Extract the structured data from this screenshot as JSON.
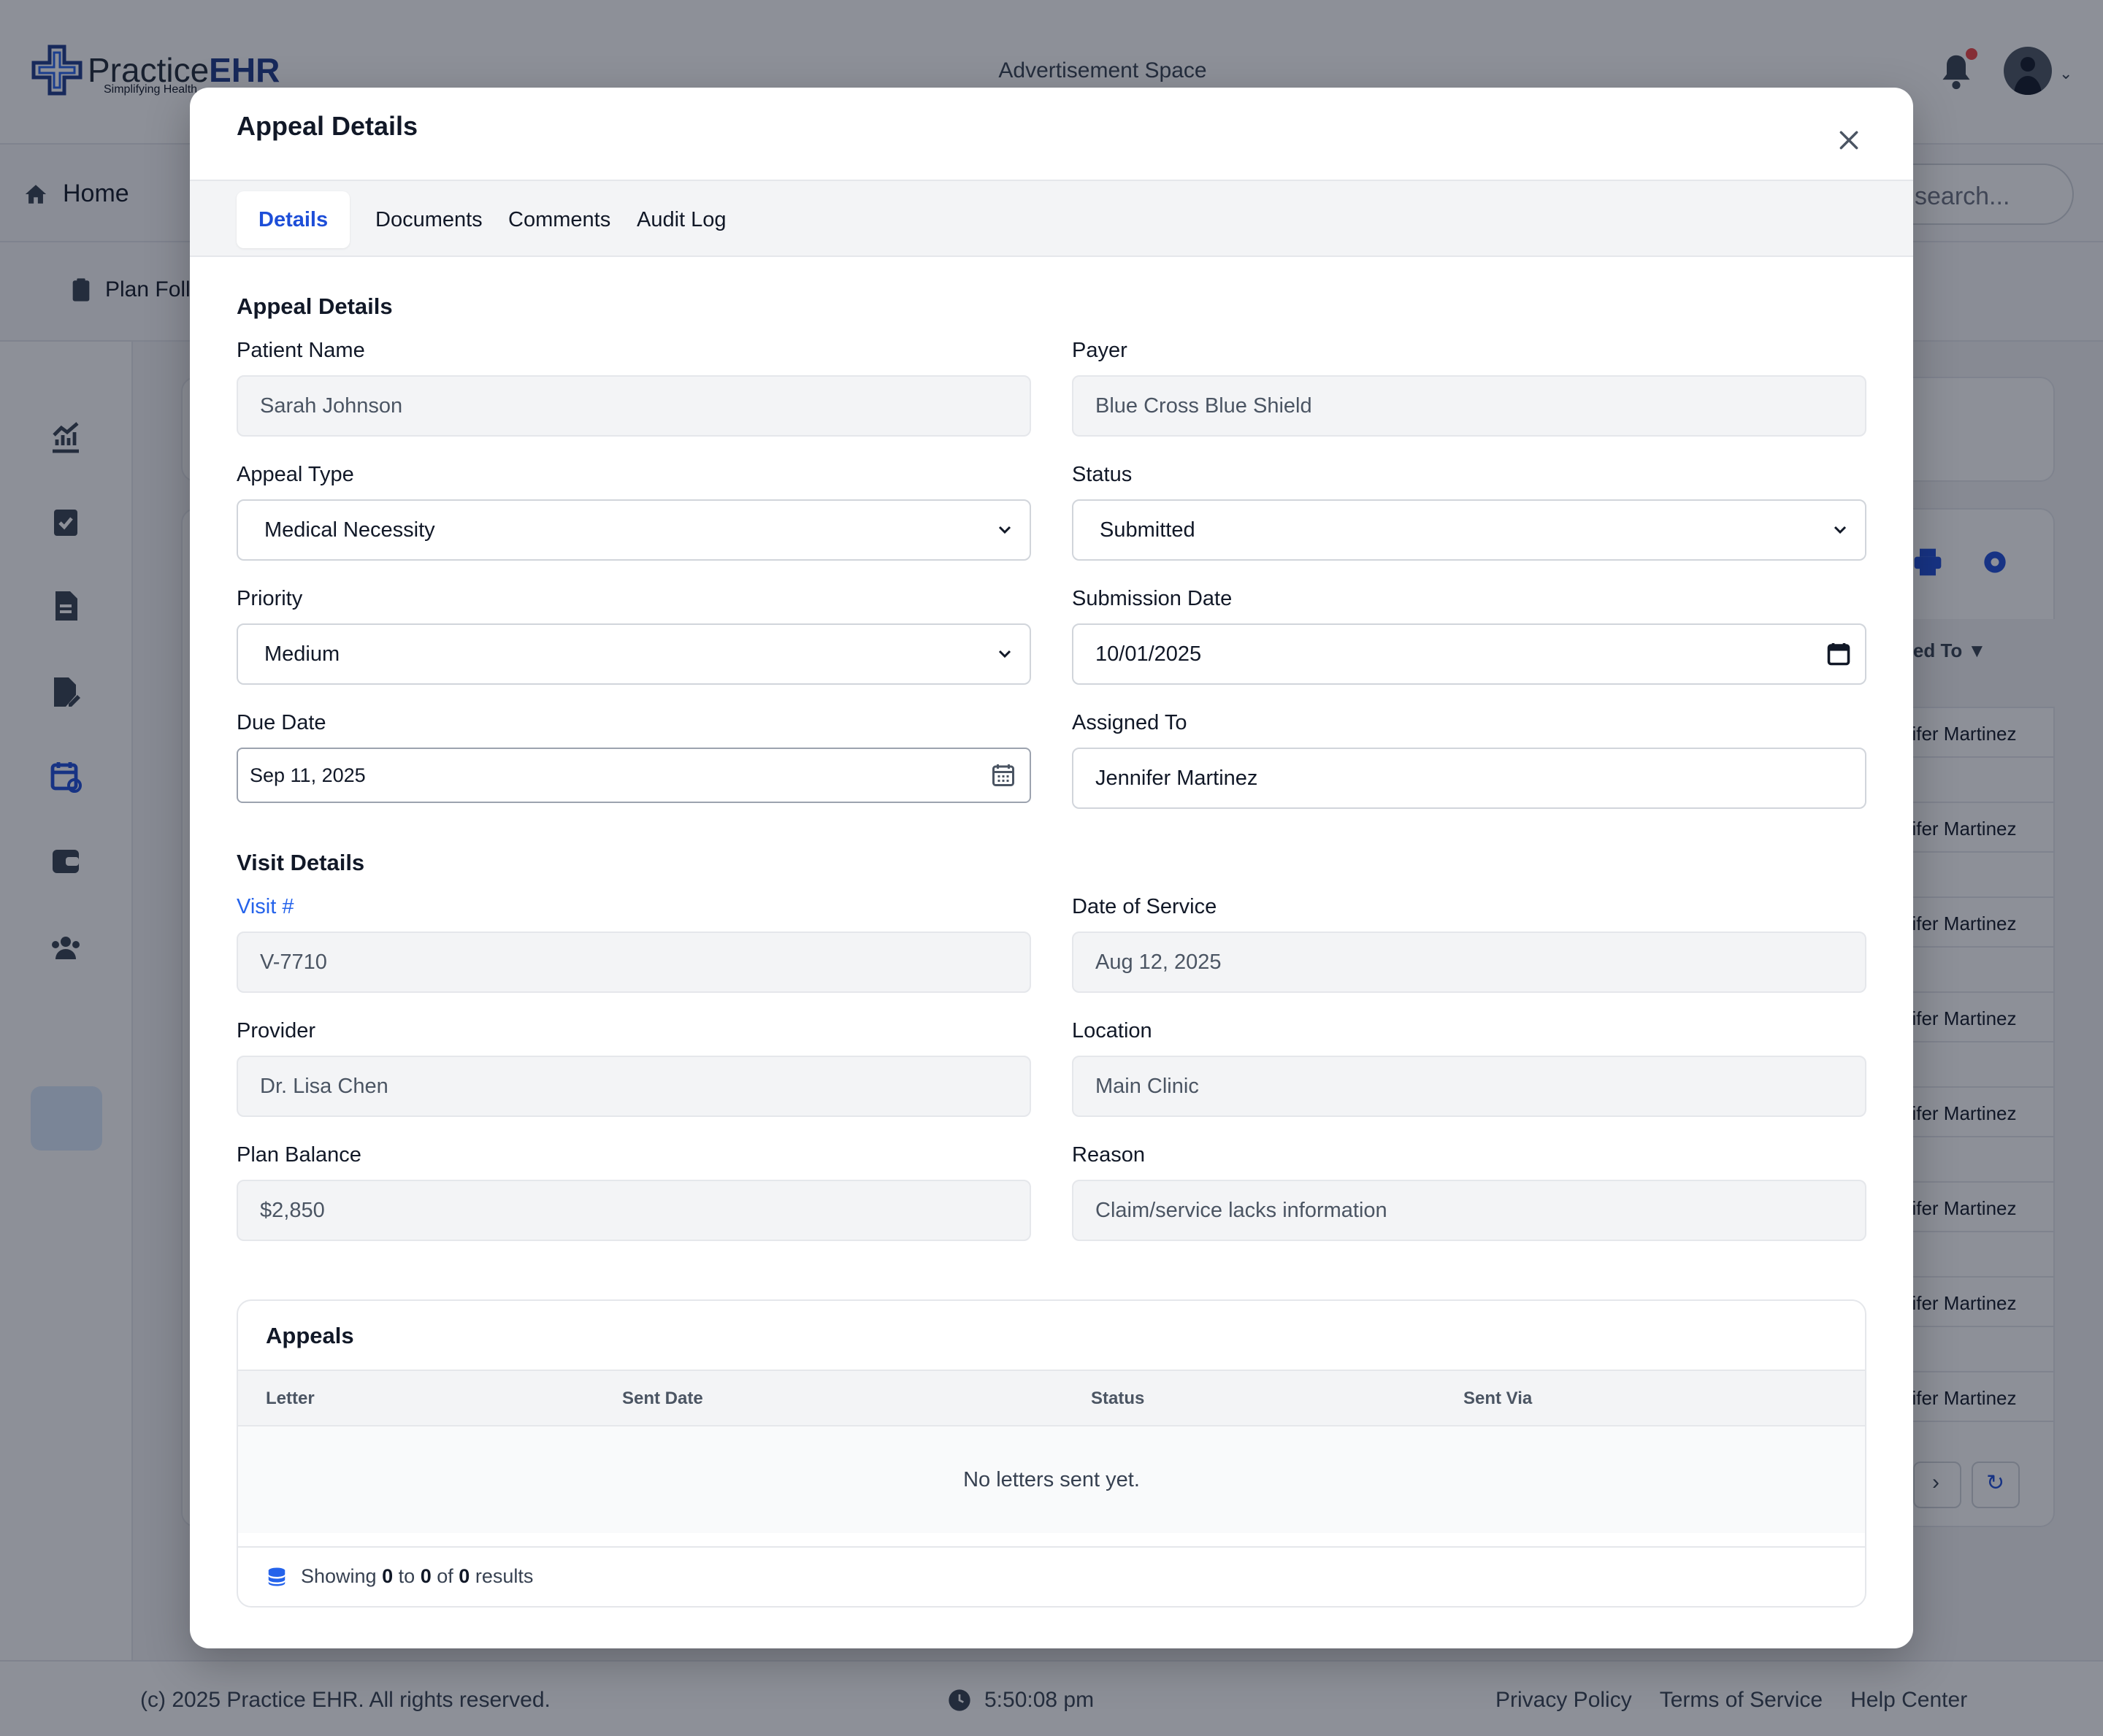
{
  "app": {
    "logo_text_a": "Practice",
    "logo_text_b": "EHR",
    "logo_tagline": "Simplifying Health",
    "ad_space": "Advertisement Space",
    "nav_home": "Home",
    "nav_search_placeholder": "search...",
    "subnav_item": "Plan Foll",
    "table_header_partial": "ned To",
    "assigned_rows": [
      "nifer Martinez",
      "nifer Martinez",
      "nifer Martinez",
      "nifer Martinez",
      "nifer Martinez",
      "nifer Martinez",
      "nifer Martinez",
      "nifer Martinez"
    ],
    "footer": {
      "copyright": "(c) 2025 Practice EHR. All rights reserved.",
      "time": "5:50:08 pm",
      "links": [
        "Privacy Policy",
        "Terms of Service",
        "Help Center"
      ]
    }
  },
  "modal": {
    "title": "Appeal Details",
    "tabs": [
      "Details",
      "Documents",
      "Comments",
      "Audit Log"
    ],
    "active_tab": "Details",
    "section_appeal": "Appeal Details",
    "section_visit": "Visit Details",
    "fields": {
      "patient_name": {
        "label": "Patient Name",
        "value": "Sarah Johnson"
      },
      "payer": {
        "label": "Payer",
        "value": "Blue Cross Blue Shield"
      },
      "appeal_type": {
        "label": "Appeal Type",
        "value": "Medical Necessity"
      },
      "status": {
        "label": "Status",
        "value": "Submitted"
      },
      "priority": {
        "label": "Priority",
        "value": "Medium"
      },
      "submission_date": {
        "label": "Submission Date",
        "value": "10/01/2025"
      },
      "due_date": {
        "label": "Due Date",
        "value": "Sep 11, 2025"
      },
      "assigned_to": {
        "label": "Assigned To",
        "value": "Jennifer Martinez"
      },
      "visit_no": {
        "label": "Visit #",
        "value": "V-7710"
      },
      "date_of_service": {
        "label": "Date of Service",
        "value": "Aug 12, 2025"
      },
      "provider": {
        "label": "Provider",
        "value": "Dr. Lisa Chen"
      },
      "location": {
        "label": "Location",
        "value": "Main Clinic"
      },
      "plan_balance": {
        "label": "Plan Balance",
        "value": "$2,850"
      },
      "reason": {
        "label": "Reason",
        "value": "Claim/service lacks information"
      }
    },
    "appeals": {
      "title": "Appeals",
      "columns": [
        "Letter",
        "Sent Date",
        "Status",
        "Sent Via"
      ],
      "empty": "No letters sent yet.",
      "showing": "Showing",
      "from": "0",
      "to_word": "to",
      "to": "0",
      "of_word": "of",
      "total": "0",
      "results_word": "results"
    }
  },
  "colors": {
    "accent": "#1d4ed8",
    "link": "#2563eb",
    "brand": "#1e3a8a",
    "notification": "#ef4444"
  },
  "icons": [
    "close-icon",
    "bell-icon",
    "home-icon",
    "calendar-icon",
    "chevron-down-icon",
    "database-icon",
    "clock-icon"
  ]
}
